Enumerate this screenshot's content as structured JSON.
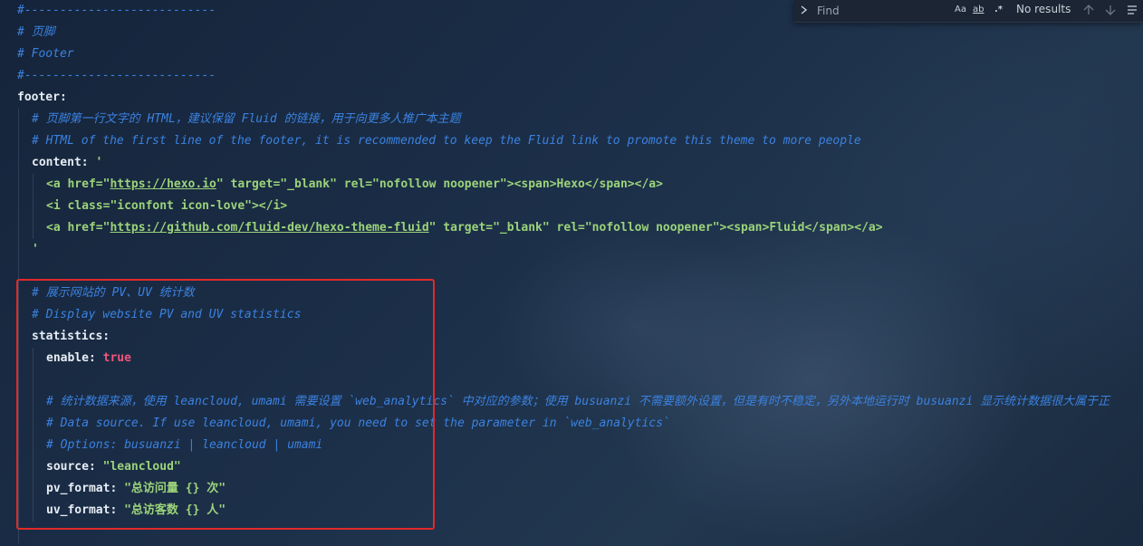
{
  "find_widget": {
    "placeholder": "Find",
    "result": "No results",
    "match_case_label": "Aa",
    "whole_word_label": "ab",
    "regex_label": ".*"
  },
  "lines": [
    "#---------------------------",
    "# 页脚",
    "# Footer",
    "#---------------------------",
    "footer:",
    "# 页脚第一行文字的 HTML，建议保留 Fluid 的链接，用于向更多人推广本主题",
    "# HTML of the first line of the footer, it is recommended to keep the Fluid link to promote this theme to more people",
    "content:",
    "'",
    "<a href=\"",
    "https://hexo.io",
    "\" target=\"_blank\" rel=\"nofollow noopener\"><span>Hexo</span></a>",
    "<i class=\"iconfont icon-love\"></i>",
    "<a href=\"",
    "https://github.com/fluid-dev/hexo-theme-fluid",
    "\" target=\"_blank\" rel=\"nofollow noopener\"><span>Fluid</span></a>",
    "'",
    "# 展示网站的 PV、UV 统计数",
    "# Display website PV and UV statistics",
    "statistics:",
    "enable:",
    "true",
    "# 统计数据来源，使用 leancloud, umami 需要设置 `web_analytics` 中对应的参数；使用 busuanzi 不需要额外设置，但是有时不稳定，另外本地运行时 busuanzi 显示统计数据很大属于正",
    "# Data source. If use leancloud, umami, you need to set the parameter in `web_analytics`",
    "# Options: busuanzi | leancloud | umami",
    "source:",
    "\"leancloud\"",
    "pv_format:",
    "\"总访问量 {} 次\"",
    "uv_format:",
    "\"总访客数 {} 人\""
  ],
  "colors": {
    "comment": "#3b82e0",
    "key": "#e7edf4",
    "string": "#9bd37a",
    "boolean": "#f0557a",
    "highlight_border": "#e02a2a"
  }
}
